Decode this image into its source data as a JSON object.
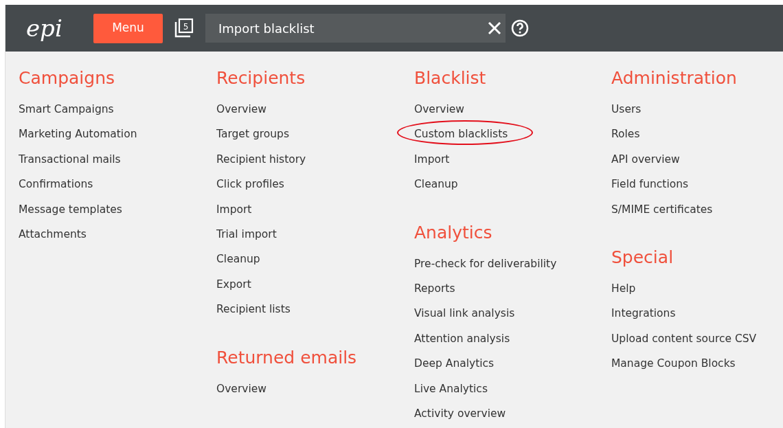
{
  "topbar": {
    "logo": "epi",
    "menu_button": "Menu",
    "open_windows_count": "5",
    "search": {
      "value": "Import blacklist"
    }
  },
  "columns": [
    {
      "sections": [
        {
          "title": "Campaigns",
          "items": [
            {
              "label": "Smart Campaigns",
              "highlighted": false
            },
            {
              "label": "Marketing Automation",
              "highlighted": false
            },
            {
              "label": "Transactional mails",
              "highlighted": false
            },
            {
              "label": "Confirmations",
              "highlighted": false
            },
            {
              "label": "Message templates",
              "highlighted": false
            },
            {
              "label": "Attachments",
              "highlighted": false
            }
          ]
        }
      ]
    },
    {
      "sections": [
        {
          "title": "Recipients",
          "items": [
            {
              "label": "Overview",
              "highlighted": false
            },
            {
              "label": "Target groups",
              "highlighted": false
            },
            {
              "label": "Recipient history",
              "highlighted": false
            },
            {
              "label": "Click profiles",
              "highlighted": false
            },
            {
              "label": "Import",
              "highlighted": false
            },
            {
              "label": "Trial import",
              "highlighted": false
            },
            {
              "label": "Cleanup",
              "highlighted": false
            },
            {
              "label": "Export",
              "highlighted": false
            },
            {
              "label": "Recipient lists",
              "highlighted": false
            }
          ]
        },
        {
          "title": "Returned emails",
          "items": [
            {
              "label": "Overview",
              "highlighted": false
            }
          ]
        }
      ]
    },
    {
      "sections": [
        {
          "title": "Blacklist",
          "items": [
            {
              "label": "Overview",
              "highlighted": false
            },
            {
              "label": "Custom blacklists",
              "highlighted": true
            },
            {
              "label": "Import",
              "highlighted": false
            },
            {
              "label": "Cleanup",
              "highlighted": false
            }
          ]
        },
        {
          "title": "Analytics",
          "items": [
            {
              "label": "Pre-check for deliverability",
              "highlighted": false
            },
            {
              "label": "Reports",
              "highlighted": false
            },
            {
              "label": "Visual link analysis",
              "highlighted": false
            },
            {
              "label": "Attention analysis",
              "highlighted": false
            },
            {
              "label": "Deep Analytics",
              "highlighted": false
            },
            {
              "label": "Live Analytics",
              "highlighted": false
            },
            {
              "label": "Activity overview",
              "highlighted": false
            }
          ]
        }
      ]
    },
    {
      "sections": [
        {
          "title": "Administration",
          "items": [
            {
              "label": "Users",
              "highlighted": false
            },
            {
              "label": "Roles",
              "highlighted": false
            },
            {
              "label": "API overview",
              "highlighted": false
            },
            {
              "label": "Field functions",
              "highlighted": false
            },
            {
              "label": "S/MIME certificates",
              "highlighted": false
            }
          ]
        },
        {
          "title": "Special",
          "items": [
            {
              "label": "Help",
              "highlighted": false
            },
            {
              "label": "Integrations",
              "highlighted": false
            },
            {
              "label": "Upload content source CSV",
              "highlighted": false
            },
            {
              "label": "Manage Coupon Blocks",
              "highlighted": false
            }
          ]
        }
      ]
    }
  ]
}
